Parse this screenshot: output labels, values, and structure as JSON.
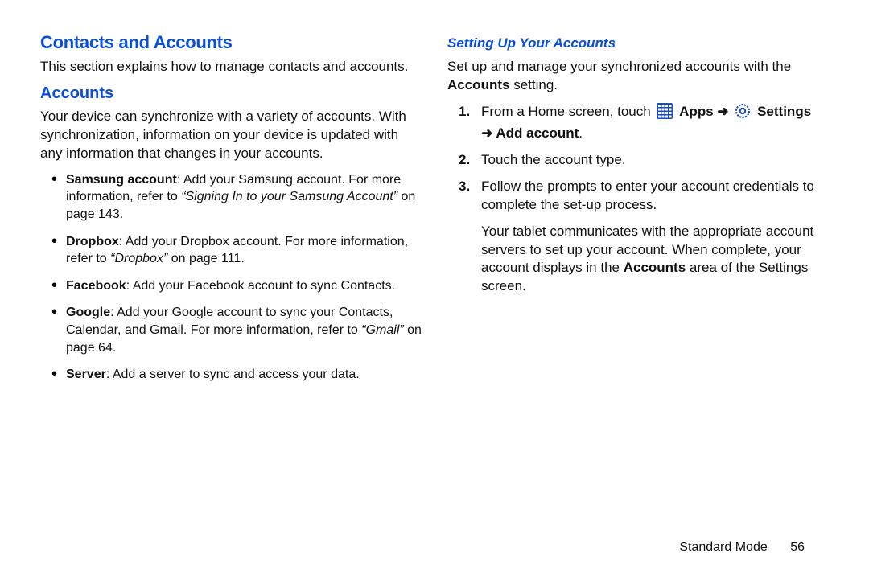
{
  "left": {
    "h1": "Contacts and Accounts",
    "intro": "This section explains how to manage contacts and accounts.",
    "h2": "Accounts",
    "para": "Your device can synchronize with a variety of accounts. With synchronization, information on your device is updated with any information that changes in your accounts.",
    "bullets": {
      "samsung": {
        "label": "Samsung account",
        "text": ": Add your Samsung account. For more information, refer to ",
        "ref": "“Signing In to your Samsung Account”",
        "tail": " on page 143."
      },
      "dropbox": {
        "label": "Dropbox",
        "text": ": Add your Dropbox account. For more information, refer to ",
        "ref": "“Dropbox”",
        "tail": " on page 111."
      },
      "facebook": {
        "label": "Facebook",
        "text": ": Add your Facebook account to sync Contacts."
      },
      "google": {
        "label": "Google",
        "text": ": Add your Google account to sync your Contacts, Calendar, and Gmail. For more information, refer to ",
        "ref": "“Gmail”",
        "tail": " on page 64."
      },
      "server": {
        "label": "Server",
        "text": ": Add a server to sync and access your data."
      }
    }
  },
  "right": {
    "h3": "Setting Up Your Accounts",
    "intro_pre": "Set up and manage your synchronized accounts with the ",
    "intro_bold": "Accounts",
    "intro_post": " setting.",
    "step1": {
      "num": "1.",
      "pre": "From a Home screen, touch ",
      "apps": "Apps",
      "arrow1": " ➜ ",
      "settings": "Settings",
      "arrow2": " ➜ ",
      "add": "Add account",
      "post": "."
    },
    "step2": {
      "num": "2.",
      "text": "Touch the account type."
    },
    "step3": {
      "num": "3.",
      "text": "Follow the prompts to enter your account credentials to complete the set-up process."
    },
    "tail_pre": "Your tablet communicates with the appropriate account servers to set up your account. When complete, your account displays in the ",
    "tail_bold": "Accounts",
    "tail_post": " area of the Settings screen."
  },
  "footer": {
    "mode": "Standard Mode",
    "page": "56"
  }
}
